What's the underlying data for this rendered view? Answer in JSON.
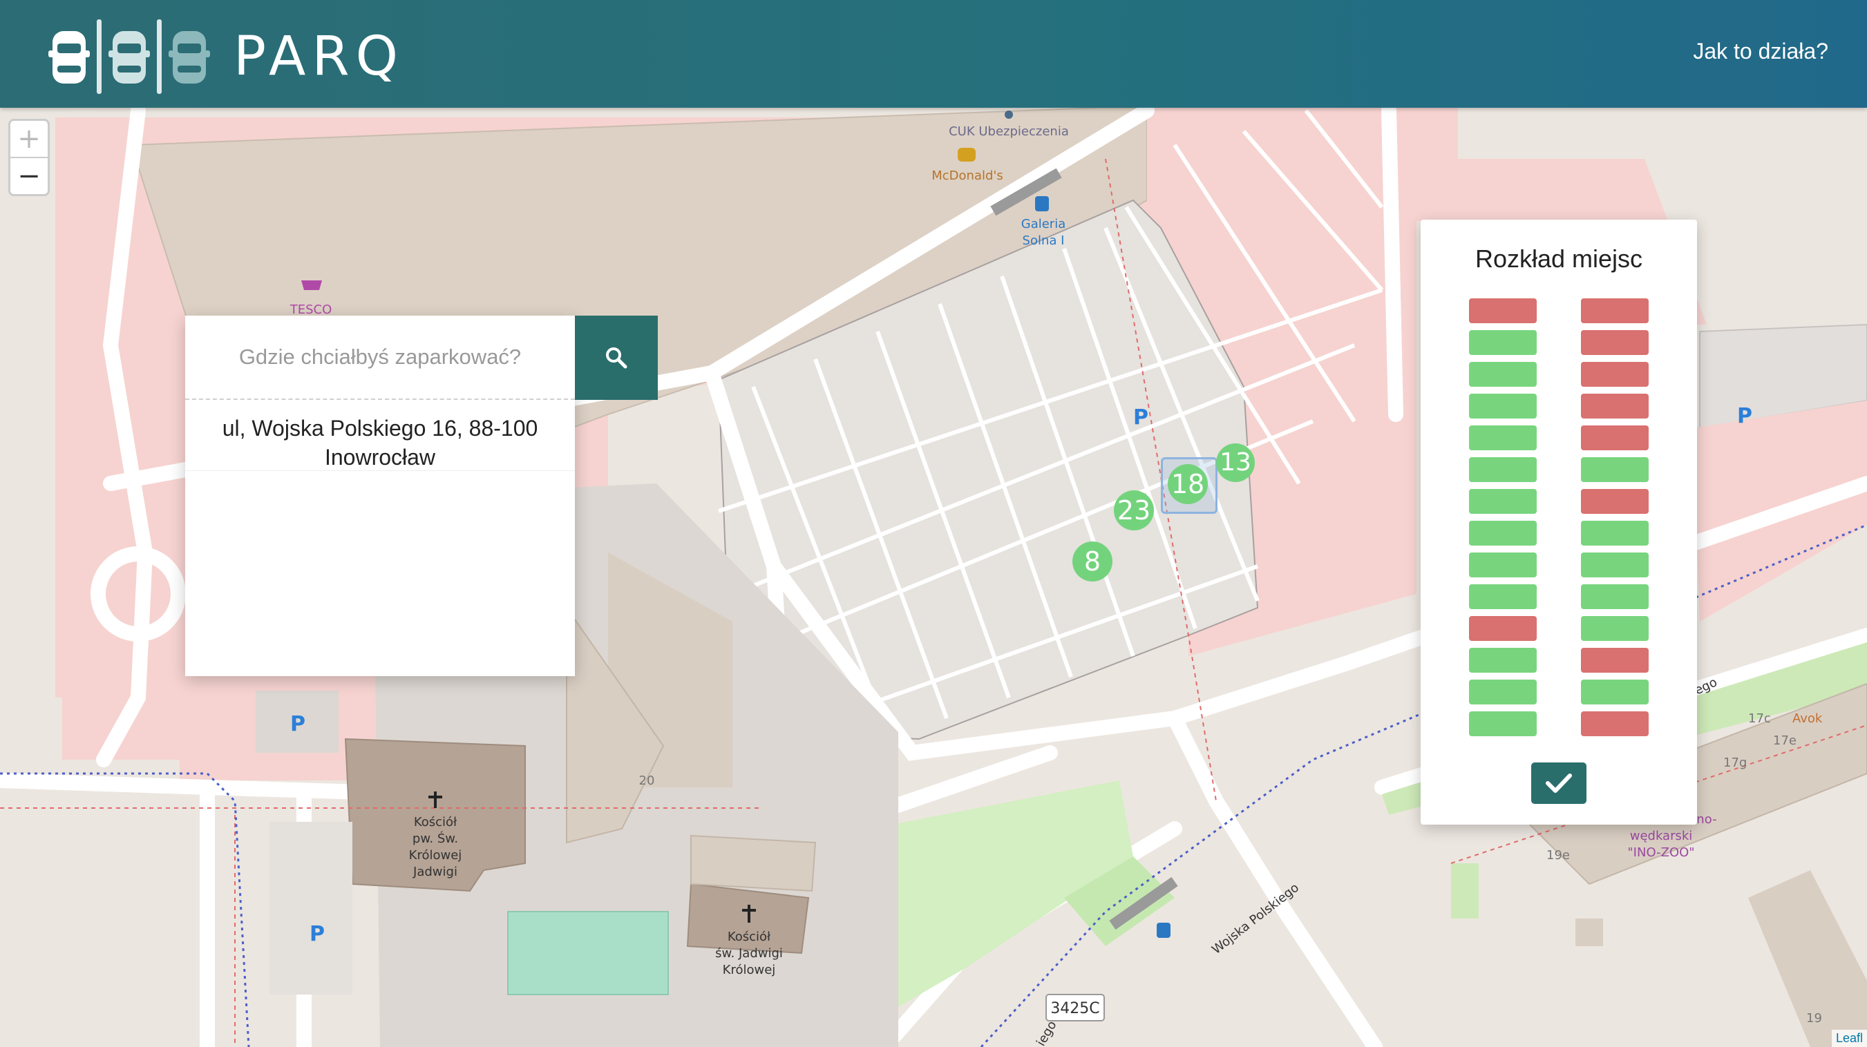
{
  "header": {
    "brand": "PARQ",
    "nav_link": "Jak to działa?"
  },
  "zoom": {
    "in_label": "+",
    "out_label": "−"
  },
  "search": {
    "placeholder": "Gdzie chciałbyś zaparkować?",
    "button_icon": "search-icon",
    "suggestions": [
      "ul, Wojska Polskiego 16, 88-100 Inowrocław"
    ]
  },
  "map_labels": {
    "poi_cuk": "CUK Ubezpieczenia",
    "poi_mcdonalds": "McDonald's",
    "poi_galeria_1": "Galeria",
    "poi_galeria_2": "Solna I",
    "poi_tesco": "TESCO",
    "church1_1": "Kościół",
    "church1_2": "pw. Św.",
    "church1_3": "Królowej",
    "church1_4": "Jadwigi",
    "church2_1": "Kościół",
    "church2_2": "św. Jadwigi",
    "church2_3": "Królowej",
    "building_20": "20",
    "road_3425c": "3425C",
    "street_wojska": "Wojska Polskiego",
    "street_iego": "iego",
    "street_ego": "ego",
    "parking": "P",
    "shop_1": "wędkarski",
    "shop_2": "\"INO-ZOO\"",
    "shop_3": "Ino-",
    "addr_17c": "17c",
    "addr_17e": "17e",
    "addr_17g": "17g",
    "addr_19e": "19e",
    "addr_19": "19",
    "addr_avo": "Avok",
    "attribution": "Leafl"
  },
  "clusters": [
    {
      "count": "13"
    },
    {
      "count": "18"
    },
    {
      "count": "23"
    },
    {
      "count": "8"
    }
  ],
  "spots_panel": {
    "title": "Rozkład miejsc",
    "left_column": [
      "taken",
      "free",
      "free",
      "free",
      "free",
      "free",
      "free",
      "free",
      "free",
      "free",
      "taken",
      "free",
      "free",
      "free"
    ],
    "right_column": [
      "taken",
      "taken",
      "taken",
      "taken",
      "taken",
      "free",
      "taken",
      "free",
      "free",
      "free",
      "free",
      "taken",
      "free",
      "taken"
    ],
    "confirm_icon": "check-icon"
  },
  "colors": {
    "header": "#25707c",
    "accent": "#2a6e6c",
    "free": "#78d57e",
    "taken": "#d8716f"
  }
}
